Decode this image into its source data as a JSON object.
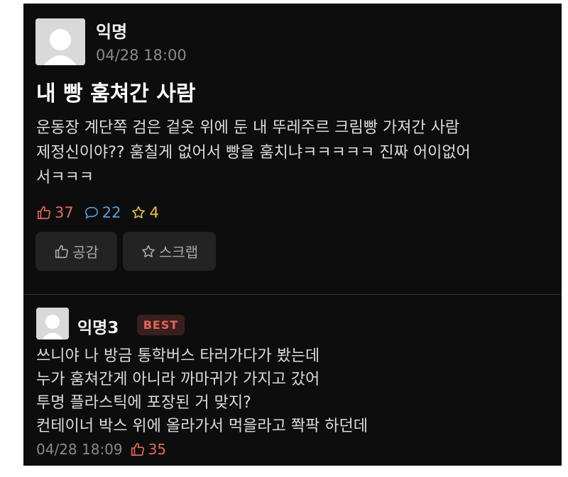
{
  "post": {
    "author": "익명",
    "time": "04/28 18:00",
    "title": "내 빵 훔쳐간 사람",
    "body_lines": [
      "운동장 계단쪽 검은 겉옷 위에 둔 내 뚜레주르 크림빵 가져간 사람",
      "제정신이야?? 훔칠게 없어서 빵을 훔치냐ㅋㅋㅋㅋㅋ 진짜 어이없어",
      "서ㅋㅋㅋ"
    ],
    "likes": "37",
    "comments": "22",
    "scraps": "4",
    "like_button": "공감",
    "scrap_button": "스크랩"
  },
  "comment": {
    "author": "익명3",
    "badge": "BEST",
    "lines": [
      "쓰니야 나 방금 통학버스 타러가다가 봤는데",
      "누가 훔쳐간게 아니라 까마귀가 가지고 갔어",
      "투명 플라스틱에 포장된 거 맞지?",
      "컨테이너 박스 위에 올라가서 먹을라고 쫙팍 하던데"
    ],
    "time": "04/28 18:09",
    "likes": "35"
  },
  "colors": {
    "background": "#0d0d0d",
    "like": "#e46a5a",
    "comment": "#5a9fd6",
    "scrap": "#e8c24a",
    "best_badge_text": "#e0685c"
  }
}
